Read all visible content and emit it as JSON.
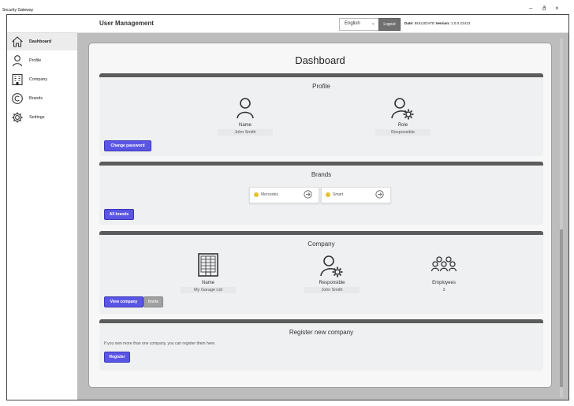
{
  "window": {
    "title": "Security Gateway",
    "controls": {
      "minimize": "–",
      "maximize": "ð",
      "close": "×"
    }
  },
  "header": {
    "app_title": "User Management",
    "language": "English",
    "logout_label": "Logout",
    "date_label": "Date:",
    "date_value": "BUILDDATE",
    "version_label": "Version:",
    "version_value": "1.0.0.22413"
  },
  "sidebar": {
    "items": [
      {
        "label": "Dashboard",
        "icon": "home-icon",
        "active": true
      },
      {
        "label": "Profile",
        "icon": "user-icon",
        "active": false
      },
      {
        "label": "Company",
        "icon": "building-icon",
        "active": false
      },
      {
        "label": "Brands",
        "icon": "copyright-icon",
        "active": false
      },
      {
        "label": "Settings",
        "icon": "gear-icon",
        "active": false
      }
    ]
  },
  "main": {
    "title": "Dashboard",
    "profile": {
      "title": "Profile",
      "name_label": "Name",
      "name_value": "John Smith",
      "role_label": "Role",
      "role_value": "Responsible",
      "change_password_label": "Change password"
    },
    "brands": {
      "title": "Brands",
      "items": [
        {
          "name": "Mercedes",
          "color": "#e5c32b"
        },
        {
          "name": "Smart",
          "color": "#e5c32b"
        }
      ],
      "all_brands_label": "All brands"
    },
    "company": {
      "title": "Company",
      "name_label": "Name",
      "name_value": "My Garage Ltd",
      "responsible_label": "Responsible",
      "responsible_value": "John Smith",
      "employees_label": "Employees",
      "employees_value": "3",
      "view_company_label": "View company",
      "invite_label": "Invite"
    },
    "register": {
      "title": "Register new company",
      "text": "If you own more than one company, you can register them here.",
      "register_label": "Register"
    }
  },
  "colors": {
    "primary_button": "#5b55e6",
    "card_header": "#5c5c5c",
    "brand_dot": "#e5c32b"
  }
}
